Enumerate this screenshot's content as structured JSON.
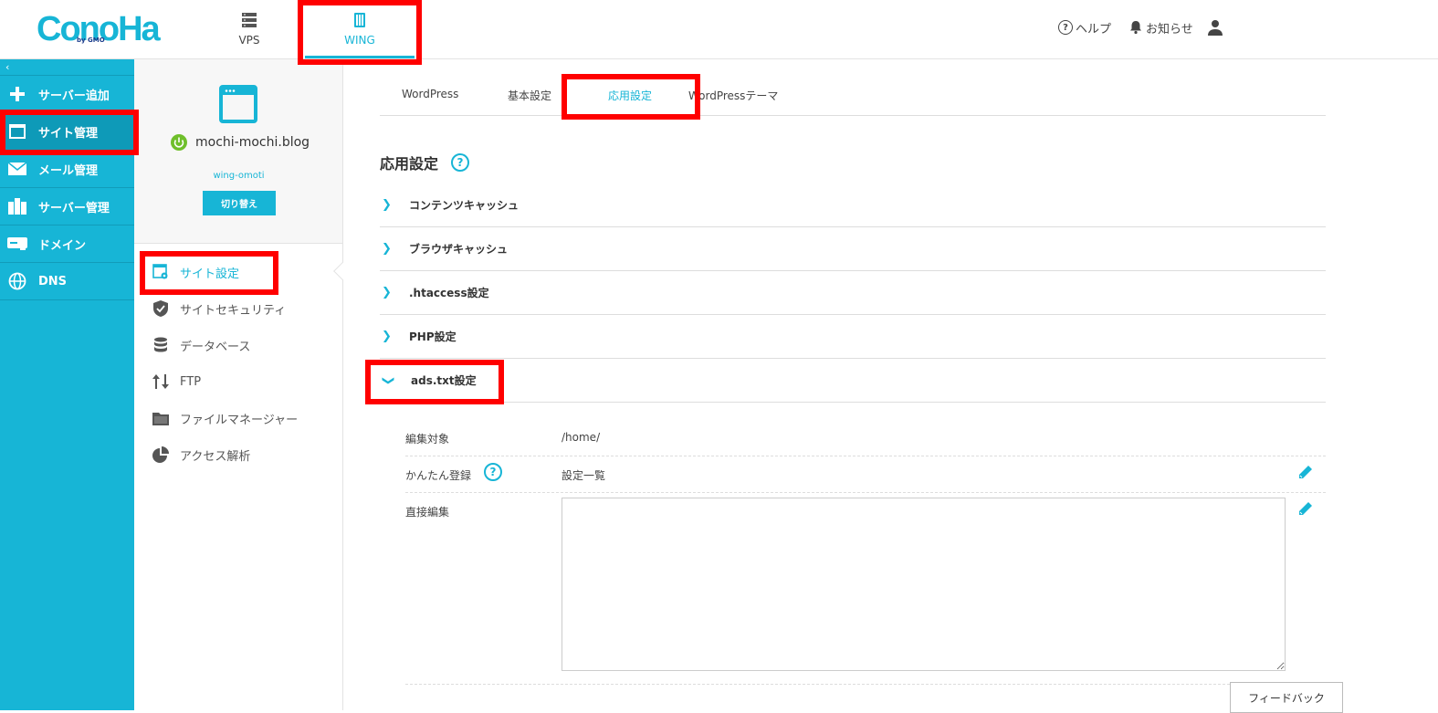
{
  "header": {
    "logo_text": "ConoHa",
    "logo_sub": "by GMO",
    "nav": [
      {
        "label": "VPS",
        "icon": "server-icon"
      },
      {
        "label": "WING",
        "icon": "wing-icon"
      }
    ],
    "help_label": "ヘルプ",
    "notice_label": "お知らせ"
  },
  "sidebar": {
    "collapse_glyph": "‹",
    "items": [
      {
        "label": "サーバー追加",
        "icon": "plus-icon"
      },
      {
        "label": "サイト管理",
        "icon": "window-icon"
      },
      {
        "label": "メール管理",
        "icon": "mail-icon"
      },
      {
        "label": "サーバー管理",
        "icon": "server-manage-icon"
      },
      {
        "label": "ドメイン",
        "icon": "domain-icon"
      },
      {
        "label": "DNS",
        "icon": "globe-icon"
      }
    ]
  },
  "site": {
    "name": "mochi-mochi.blog",
    "user": "wing-omoti",
    "switch_label": "切り替え"
  },
  "submenu": [
    {
      "label": "サイト設定",
      "icon": "site-settings-icon"
    },
    {
      "label": "サイトセキュリティ",
      "icon": "shield-icon"
    },
    {
      "label": "データベース",
      "icon": "database-icon"
    },
    {
      "label": "FTP",
      "icon": "transfer-icon"
    },
    {
      "label": "ファイルマネージャー",
      "icon": "folder-icon"
    },
    {
      "label": "アクセス解析",
      "icon": "pie-chart-icon"
    }
  ],
  "tabs": [
    "WordPress",
    "基本設定",
    "応用設定",
    "WordPressテーマ"
  ],
  "section_title": "応用設定",
  "accordions": [
    {
      "label": "コンテンツキャッシュ",
      "expanded": false
    },
    {
      "label": "ブラウザキャッシュ",
      "expanded": false
    },
    {
      "label": ".htaccess設定",
      "expanded": false
    },
    {
      "label": "PHP設定",
      "expanded": false
    },
    {
      "label": "ads.txt設定",
      "expanded": true
    }
  ],
  "ads": {
    "target_label": "編集対象",
    "target_value": "/home/",
    "easy_label": "かんたん登録",
    "easy_value": "設定一覧",
    "direct_label": "直接編集",
    "direct_value": ""
  },
  "feedback_label": "フィードバック",
  "colors": {
    "accent": "#17b5d6",
    "highlight": "#ff0000"
  }
}
